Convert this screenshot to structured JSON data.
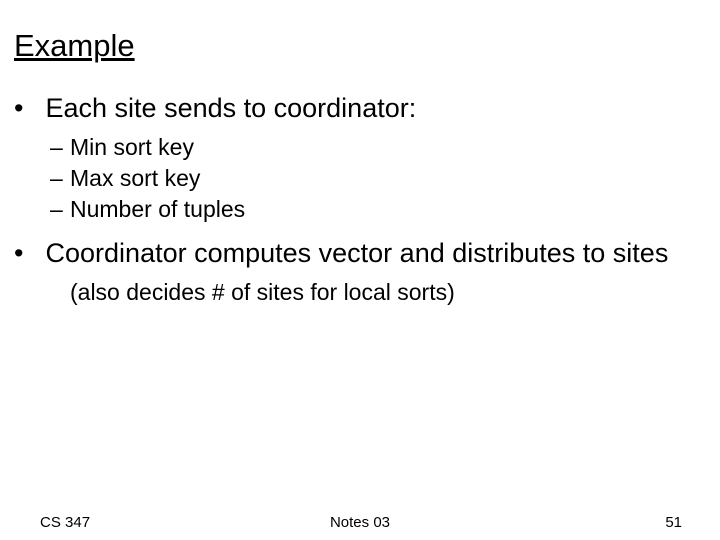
{
  "title": "Example",
  "bullets": [
    {
      "text": "Each site sends to coordinator:",
      "sub": [
        "Min sort key",
        "Max sort key",
        "Number of tuples"
      ]
    },
    {
      "text": "Coordinator computes vector and distributes to sites",
      "note": "(also decides # of sites for local sorts)"
    }
  ],
  "footer": {
    "left": "CS 347",
    "center": "Notes 03",
    "right": "51"
  }
}
